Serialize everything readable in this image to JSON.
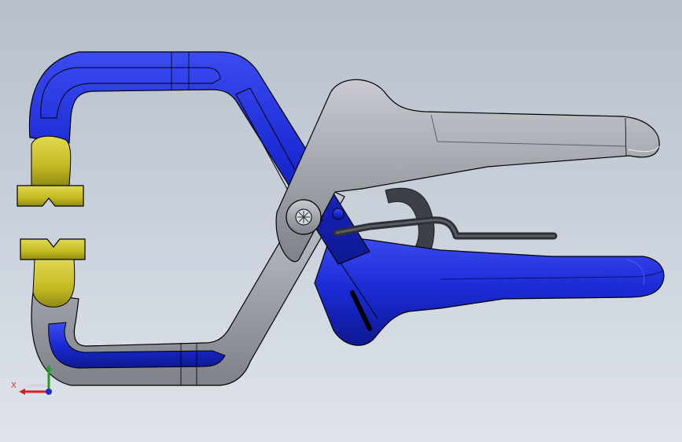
{
  "triad": {
    "x_label": "X",
    "colors": {
      "x": "#d42020",
      "y": "#20a020",
      "z": "#1a2ad4"
    }
  },
  "colors": {
    "background_top": "#b6bfcb",
    "background_bottom": "#dfe4ea",
    "blue_part": "#1a2ad4",
    "gray_part": "#9a9ca4",
    "yellow_pad": "#c8c028",
    "spring_dark": "#3a3c42"
  },
  "model": {
    "parts": [
      "upper-jaw-blue",
      "lower-jaw-gray",
      "upper-handle-gray",
      "lower-handle-blue",
      "pivot-screw",
      "swivel-pads-yellow",
      "return-spring"
    ]
  }
}
